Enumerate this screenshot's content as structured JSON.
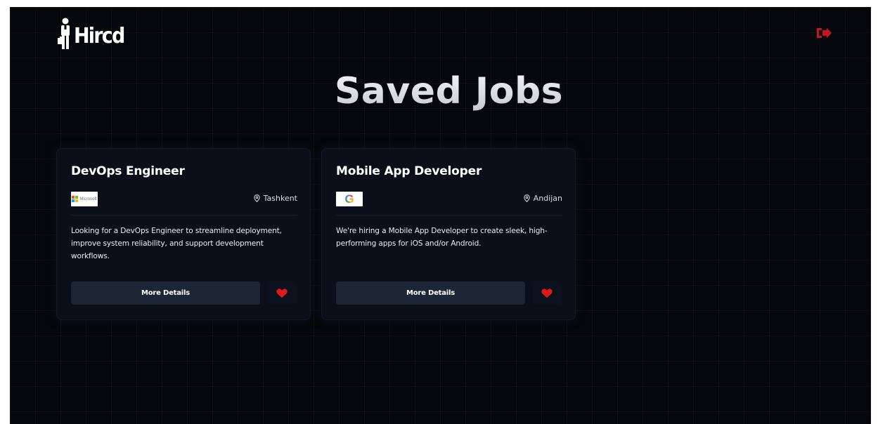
{
  "app": {
    "logo_text": "Hircd",
    "logo_icon": "briefcase-person-icon",
    "logout_icon": "logout-icon"
  },
  "page": {
    "title": "Saved Jobs"
  },
  "colors": {
    "background": "#05070c",
    "card": "#0a0f1a",
    "button": "#1d2634",
    "heart": "#e0191d",
    "logout": "#c4161c"
  },
  "jobs": [
    {
      "title": "DevOps Engineer",
      "company_logo": "microsoft-logo",
      "company_logo_text": "Microsoft",
      "location": "Tashkent",
      "description": "Looking for a DevOps Engineer to streamline deployment, improve system reliability, and support development workflows.",
      "details_label": "More Details",
      "saved": true
    },
    {
      "title": "Mobile App Developer",
      "company_logo": "google-logo",
      "company_logo_text": "G",
      "location": "Andijan",
      "description": "We're hiring a Mobile App Developer to create sleek, high-performing apps for iOS and/or Android.",
      "details_label": "More Details",
      "saved": true
    }
  ]
}
